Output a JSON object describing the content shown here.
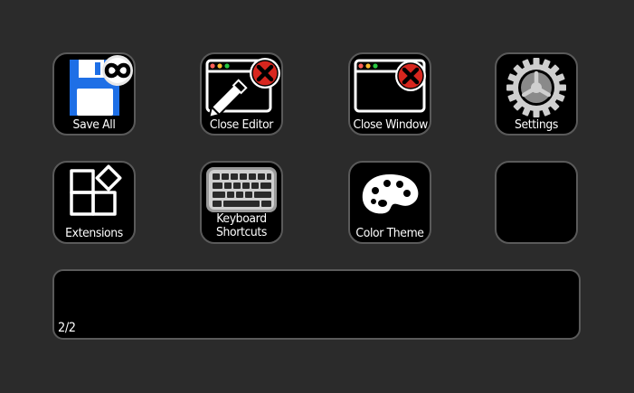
{
  "keys": {
    "save_all": {
      "label": "Save All",
      "icon": "save-all-icon"
    },
    "close_editor": {
      "label": "Close Editor",
      "icon": "close-editor-icon"
    },
    "close_window": {
      "label": "Close Window",
      "icon": "close-window-icon"
    },
    "settings": {
      "label": "Settings",
      "icon": "gear-icon"
    },
    "extensions": {
      "label": "Extensions",
      "icon": "extensions-icon"
    },
    "keyboard_shortcuts": {
      "label_line1": "Keyboard",
      "label_line2": "Shortcuts",
      "icon": "keyboard-icon"
    },
    "color_theme": {
      "label": "Color Theme",
      "icon": "palette-icon"
    },
    "empty": {
      "label": ""
    }
  },
  "footer": {
    "page": "2/2"
  },
  "colors": {
    "background": "#2b2b2b",
    "key_face": "#000000",
    "key_border": "#5a5a5a",
    "save_blue": "#1e6fe6",
    "close_red": "#d7261e",
    "traffic_red": "#ff5f57",
    "traffic_yellow": "#febc2e",
    "traffic_green": "#28c840"
  }
}
